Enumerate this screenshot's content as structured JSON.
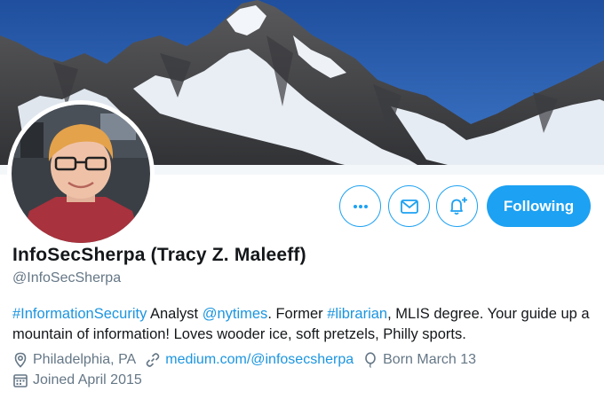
{
  "profile": {
    "display_name": "InfoSecSherpa (Tracy Z. Maleeff)",
    "handle": "@InfoSecSherpa",
    "bio_parts": {
      "hashtag1": "#InformationSecurity",
      "text1": " Analyst ",
      "mention": "@nytimes",
      "text2": ". Former ",
      "hashtag2": "#librarian",
      "text3": ", MLIS degree. Your guide up a mountain of information! Loves wooder ice, soft pretzels, Philly sports."
    },
    "location": "Philadelphia, PA",
    "website": "medium.com/@infosecsherpa",
    "birthday": "Born March 13",
    "joined": "Joined April 2015"
  },
  "actions": {
    "more_icon": "more-dots-icon",
    "message_icon": "envelope-icon",
    "notify_icon": "bell-plus-icon",
    "follow_label": "Following"
  },
  "colors": {
    "accent": "#1da1f2",
    "link": "#1b95e0",
    "muted": "#657786",
    "text": "#14171a"
  }
}
